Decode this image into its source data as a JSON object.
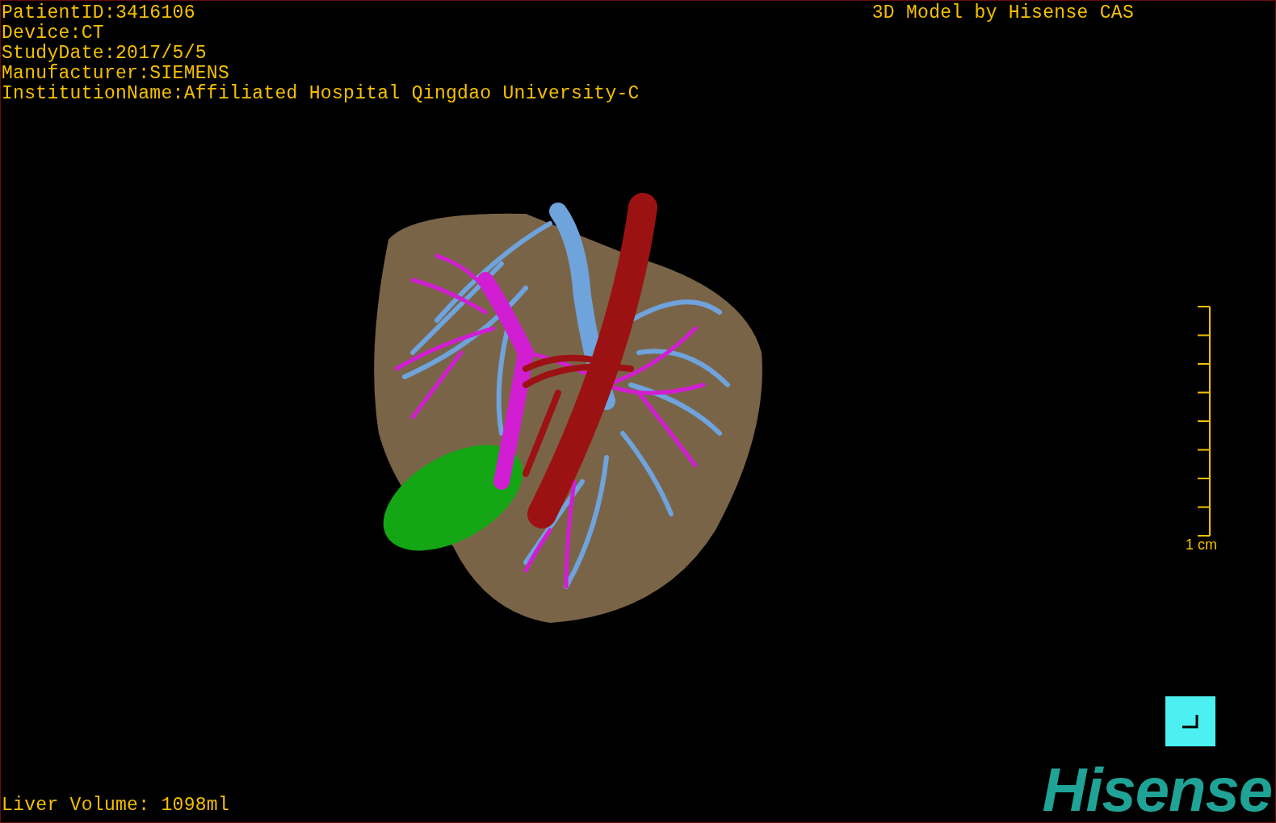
{
  "overlay": {
    "patient_info": [
      "PatientID:3416106",
      "Device:CT",
      "StudyDate:2017/5/5",
      "Manufacturer:SIEMENS",
      "InstitutionName:Affiliated Hospital Qingdao University-C"
    ],
    "title": "3D Model by Hisense CAS"
  },
  "scale": {
    "label": "1 cm"
  },
  "measurement": "Liver Volume: 1098ml",
  "logo": "Hisense"
}
